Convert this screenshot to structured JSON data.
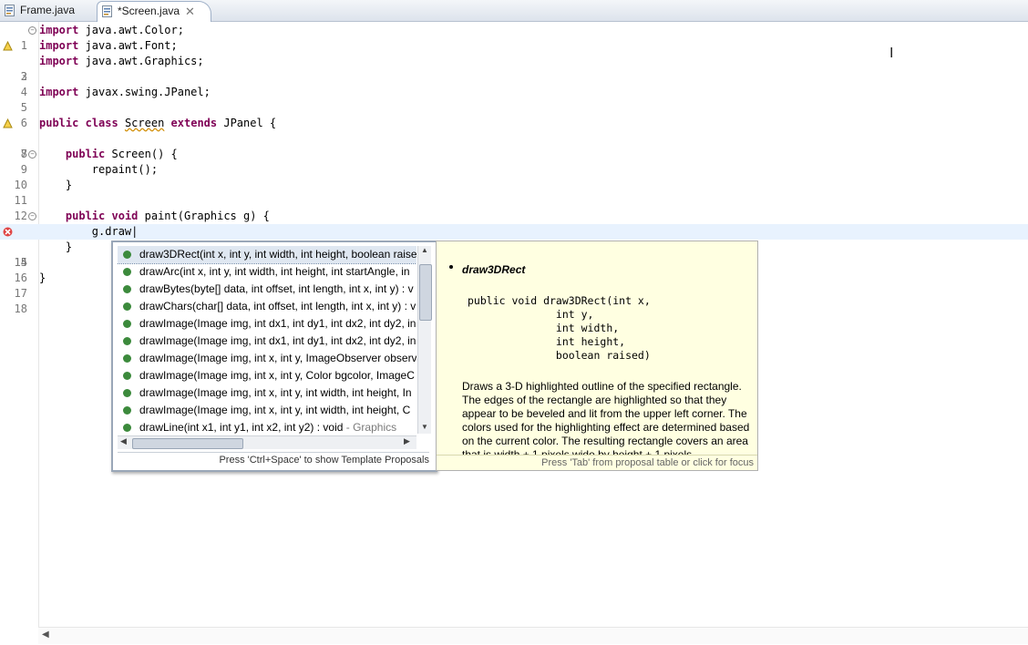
{
  "tabs": [
    {
      "label": "Frame.java"
    },
    {
      "label": "*Screen.java"
    }
  ],
  "code_lines": [
    {
      "no": "1",
      "text": "import java.awt.Color;"
    },
    {
      "no": "2",
      "text": "import java.awt.Font;"
    },
    {
      "no": "3",
      "text": "import java.awt.Graphics;"
    },
    {
      "no": "4",
      "text": ""
    },
    {
      "no": "5",
      "text": "import javax.swing.JPanel;"
    },
    {
      "no": "6",
      "text": ""
    },
    {
      "no": "7",
      "text": "public class Screen extends JPanel {"
    },
    {
      "no": "8",
      "text": ""
    },
    {
      "no": "9",
      "text": "    public Screen() {"
    },
    {
      "no": "10",
      "text": "        repaint();"
    },
    {
      "no": "11",
      "text": "    }"
    },
    {
      "no": "12",
      "text": ""
    },
    {
      "no": "13",
      "text": "    public void paint(Graphics g) {"
    },
    {
      "no": "14",
      "text": "        g.draw"
    },
    {
      "no": "15",
      "text": "    }"
    },
    {
      "no": "16",
      "text": ""
    },
    {
      "no": "17",
      "text": "}"
    },
    {
      "no": "18",
      "text": ""
    }
  ],
  "proposals": [
    {
      "text": "draw3DRect(int x, int y, int width, int height, boolean raise",
      "suffix": ""
    },
    {
      "text": "drawArc(int x, int y, int width, int height, int startAngle, in",
      "suffix": ""
    },
    {
      "text": "drawBytes(byte[] data, int offset, int length, int x, int y) : v",
      "suffix": ""
    },
    {
      "text": "drawChars(char[] data, int offset, int length, int x, int y) : v",
      "suffix": ""
    },
    {
      "text": "drawImage(Image img, int dx1, int dy1, int dx2, int dy2, in",
      "suffix": ""
    },
    {
      "text": "drawImage(Image img, int dx1, int dy1, int dx2, int dy2, in",
      "suffix": ""
    },
    {
      "text": "drawImage(Image img, int x, int y, ImageObserver observ",
      "suffix": ""
    },
    {
      "text": "drawImage(Image img, int x, int y, Color bgcolor, ImageC",
      "suffix": ""
    },
    {
      "text": "drawImage(Image img, int x, int y, int width, int height, In",
      "suffix": ""
    },
    {
      "text": "drawImage(Image img, int x, int y, int width, int height, C",
      "suffix": ""
    },
    {
      "text": "drawLine(int x1, int y1, int x2, int y2) : void",
      "suffix": " - Graphics"
    }
  ],
  "proposal_footer": "Press 'Ctrl+Space' to show Template Proposals",
  "doc": {
    "title": "draw3DRect",
    "signature": "public void draw3DRect(int x,\n              int y,\n              int width,\n              int height,\n              boolean raised)",
    "description": "Draws a 3-D highlighted outline of the specified rectangle. The edges of the rectangle are highlighted so that they appear to be beveled and lit from the upper left corner. The colors used for the highlighting effect are determined based on the current color. The resulting rectangle covers an area that is width + 1 pixels wide by height + 1 pixels",
    "footer": "Press 'Tab' from proposal table or click for focus"
  },
  "icons": {
    "file": "java-file-icon",
    "close": "close-icon",
    "fold": "fold-minus-icon",
    "error": "error-icon",
    "warning": "warning-icon"
  },
  "colors": {
    "keyword": "#7f0055",
    "current_line": "#e8f2fe",
    "doc_background": "#ffffe1"
  }
}
